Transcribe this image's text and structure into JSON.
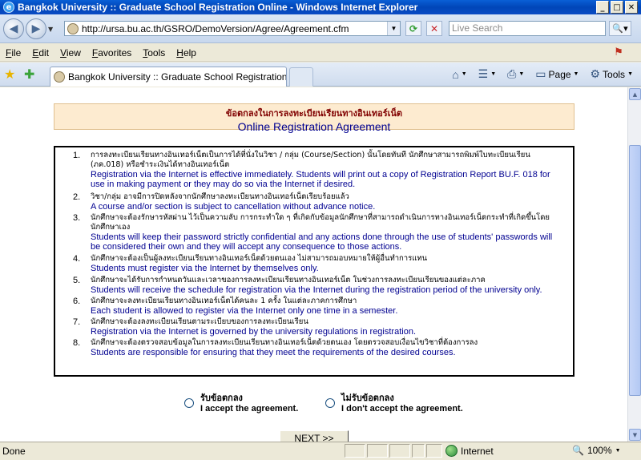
{
  "window": {
    "title": "Bangkok University :: Graduate School Registration Online - Windows Internet Explorer",
    "icon": "ie-icon",
    "buttons": [
      "_",
      "□",
      "✕"
    ]
  },
  "address_bar": {
    "url": "http://ursa.bu.ac.th/GSRO/DemoVersion/Agree/Agreement.cfm",
    "search_placeholder": "Live Search"
  },
  "menu": {
    "items": [
      {
        "label": "File",
        "underline": "F",
        "rest": "ile"
      },
      {
        "label": "Edit",
        "underline": "E",
        "rest": "dit"
      },
      {
        "label": "View",
        "underline": "V",
        "rest": "iew"
      },
      {
        "label": "Favorites",
        "underline": "F",
        "rest": "avorites"
      },
      {
        "label": "Tools",
        "underline": "T",
        "rest": "ools"
      },
      {
        "label": "Help",
        "underline": "H",
        "rest": "elp"
      }
    ]
  },
  "tab": {
    "label": "Bangkok University :: Graduate School Registration O..."
  },
  "command_bar": {
    "page_label": "Page",
    "tools_label": "Tools"
  },
  "page": {
    "heading_th": "ข้อตกลงในการลงทะเบียนเรียนทางอินเทอร์เน็ต",
    "heading_en": "Online Registration Agreement",
    "items": [
      {
        "num": "1.",
        "th": "การลงทะเบียนเรียนทางอินเทอร์เน็ตเป็นการได้ที่นั่งในวิชา / กลุ่ม (Course/Section) นั้นโดยทันที นักศึกษาสามารถพิมพ์ใบทะเบียนเรียน (ภค.018) หรือชำระเงินได้ทางอินเทอร์เน็ต",
        "en": "Registration via the Internet is effective immediately. Students will print out a copy of Registration Report BU.F. 018 for use in making payment or they may do so via the Internet if desired."
      },
      {
        "num": "2.",
        "th": "วิชา/กลุ่ม อาจมีการปิดหลังจากนักศึกษาลงทะเบียนทางอินเทอร์เน็ตเรียบร้อยแล้ว",
        "en": "A course and/or section is subject to cancellation without advance notice."
      },
      {
        "num": "3.",
        "th": "นักศึกษาจะต้องรักษารหัสผ่าน ไว้เป็นความลับ การกระทำใด ๆ ที่เกิดกับข้อมูลนักศึกษาที่สามารถดำเนินการทางอินเทอร์เน็ตกระทำที่เกิดขึ้นโดยนักศึกษาเอง",
        "en": "Students will keep their password strictly confidential and any actions done through the use of students' passwords will be considered their own and they will accept any consequence to those actions."
      },
      {
        "num": "4.",
        "th": "นักศึกษาจะต้องเป็นผู้ลงทะเบียนเรียนทางอินเทอร์เน็ตด้วยตนเอง ไม่สามารถมอบหมายให้ผู้อื่นทำการแทน",
        "en": "Students must register via the Internet by themselves only."
      },
      {
        "num": "5.",
        "th": "นักศึกษาจะได้รับการกำหนดวันและเวลาของการลงทะเบียนเรียนทางอินเทอร์เน็ต ในช่วงการลงทะเบียนเรียนของแต่ละภาค",
        "en": "Students will receive the schedule for registration via the Internet during the registration period of the university only."
      },
      {
        "num": "6.",
        "th": "นักศึกษาจะลงทะเบียนเรียนทางอินเทอร์เน็ตได้คนละ 1 ครั้ง ในแต่ละภาคการศึกษา",
        "en": "Each student is allowed to register via the Internet only one time in a semester."
      },
      {
        "num": "7.",
        "th": "นักศึกษาจะต้องลงทะเบียนเรียนตามระเบียบของการลงทะเบียนเรียน",
        "en": "Registration via the Internet is governed by the university regulations in registration."
      },
      {
        "num": "8.",
        "th": "นักศึกษาจะต้องตรวจสอบข้อมูลในการลงทะเบียนเรียนทางอินเทอร์เน็ตด้วยตนเอง โดยตรวจสอบเงื่อนไขวิชาที่ต้องการลง",
        "en": "Students are responsible for ensuring that they meet the requirements of the desired courses."
      }
    ],
    "accept_th": "รับข้อตกลง",
    "accept_en": "I accept the agreement.",
    "decline_th": "ไม่รับข้อตกลง",
    "decline_en": "I don't accept the agreement.",
    "next_label": "NEXT >>"
  },
  "status_bar": {
    "status": "Done",
    "zone": "Internet",
    "zoom": "100%"
  },
  "colors": {
    "heading_box_bg": "#fdebd0",
    "heading_th": "#800000",
    "english_text": "#000090"
  }
}
